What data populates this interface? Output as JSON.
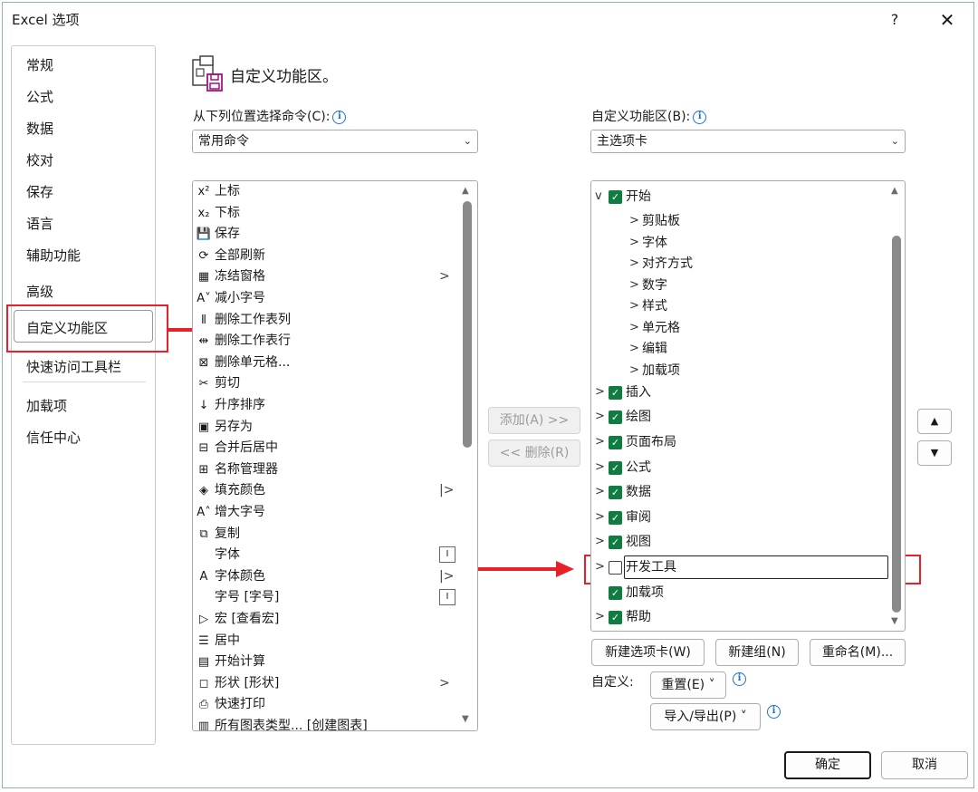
{
  "window": {
    "title": "Excel 选项",
    "help": "?",
    "close": "✕"
  },
  "nav": {
    "items": [
      "常规",
      "公式",
      "数据",
      "校对",
      "保存",
      "语言",
      "辅助功能",
      "高级",
      "自定义功能区",
      "快速访问工具栏",
      "加载项",
      "信任中心"
    ],
    "selected_index": 8
  },
  "header": {
    "title": "自定义功能区。"
  },
  "left": {
    "label": "从下列位置选择命令(C):",
    "combo_value": "常用命令",
    "commands": [
      {
        "icon": "x²",
        "label": "上标",
        "side": ""
      },
      {
        "icon": "x₂",
        "label": "下标",
        "side": ""
      },
      {
        "icon": "💾",
        "label": "保存",
        "side": ""
      },
      {
        "icon": "⟳",
        "label": "全部刷新",
        "side": ""
      },
      {
        "icon": "▦",
        "label": "冻结窗格",
        "side": ">"
      },
      {
        "icon": "A˅",
        "label": "减小字号",
        "side": ""
      },
      {
        "icon": "⫴",
        "label": "删除工作表列",
        "side": ""
      },
      {
        "icon": "⇹",
        "label": "删除工作表行",
        "side": ""
      },
      {
        "icon": "⊠",
        "label": "删除单元格...",
        "side": ""
      },
      {
        "icon": "✂",
        "label": "剪切",
        "side": ""
      },
      {
        "icon": "↓",
        "label": "升序排序",
        "side": ""
      },
      {
        "icon": "▣",
        "label": "另存为",
        "side": ""
      },
      {
        "icon": "⊟",
        "label": "合并后居中",
        "side": ""
      },
      {
        "icon": "⊞",
        "label": "名称管理器",
        "side": ""
      },
      {
        "icon": "◈",
        "label": "填充颜色",
        "side": "|>"
      },
      {
        "icon": "A˄",
        "label": "增大字号",
        "side": ""
      },
      {
        "icon": "⧉",
        "label": "复制",
        "side": ""
      },
      {
        "icon": "",
        "label": "字体",
        "side": "box"
      },
      {
        "icon": "A",
        "label": "字体颜色",
        "side": "|>"
      },
      {
        "icon": "",
        "label": "字号 [字号]",
        "side": "box"
      },
      {
        "icon": "▷",
        "label": "宏 [查看宏]",
        "side": ""
      },
      {
        "icon": "☰",
        "label": "居中",
        "side": ""
      },
      {
        "icon": "▤",
        "label": "开始计算",
        "side": ""
      },
      {
        "icon": "◻",
        "label": "形状 [形状]",
        "side": ">"
      },
      {
        "icon": "⎙",
        "label": "快速打印",
        "side": ""
      },
      {
        "icon": "▥",
        "label": "所有图表类型... [创建图表]",
        "side": ""
      }
    ]
  },
  "middle": {
    "add": "添加(A) >>",
    "remove": "<< 删除(R)"
  },
  "right": {
    "label": "自定义功能区(B):",
    "combo_value": "主选项卡",
    "tree": [
      {
        "label": "开始",
        "level": 0,
        "expander": "v",
        "checked": true
      },
      {
        "label": "剪贴板",
        "level": 1,
        "expander": ">",
        "checked": null
      },
      {
        "label": "字体",
        "level": 1,
        "expander": ">",
        "checked": null
      },
      {
        "label": "对齐方式",
        "level": 1,
        "expander": ">",
        "checked": null
      },
      {
        "label": "数字",
        "level": 1,
        "expander": ">",
        "checked": null
      },
      {
        "label": "样式",
        "level": 1,
        "expander": ">",
        "checked": null
      },
      {
        "label": "单元格",
        "level": 1,
        "expander": ">",
        "checked": null
      },
      {
        "label": "编辑",
        "level": 1,
        "expander": ">",
        "checked": null
      },
      {
        "label": "加载项",
        "level": 1,
        "expander": ">",
        "checked": null
      },
      {
        "label": "插入",
        "level": 0,
        "expander": ">",
        "checked": true
      },
      {
        "label": "绘图",
        "level": 0,
        "expander": ">",
        "checked": true
      },
      {
        "label": "页面布局",
        "level": 0,
        "expander": ">",
        "checked": true
      },
      {
        "label": "公式",
        "level": 0,
        "expander": ">",
        "checked": true
      },
      {
        "label": "数据",
        "level": 0,
        "expander": ">",
        "checked": true
      },
      {
        "label": "审阅",
        "level": 0,
        "expander": ">",
        "checked": true
      },
      {
        "label": "视图",
        "level": 0,
        "expander": ">",
        "checked": true
      },
      {
        "label": "开发工具",
        "level": 0,
        "expander": ">",
        "checked": false
      },
      {
        "label": "加载项",
        "level": 0,
        "expander": "",
        "checked": true
      },
      {
        "label": "帮助",
        "level": 0,
        "expander": ">",
        "checked": true
      }
    ],
    "new_tab": "新建选项卡(W)",
    "new_group": "新建组(N)",
    "rename": "重命名(M)...",
    "custom_label": "自定义:",
    "reset": "重置(E) ˅",
    "import_export": "导入/导出(P) ˅",
    "move_up": "▲",
    "move_down": "▼"
  },
  "footer": {
    "ok": "确定",
    "cancel": "取消"
  },
  "colors": {
    "accent_red": "#e8202a",
    "check_green": "#107c41"
  }
}
